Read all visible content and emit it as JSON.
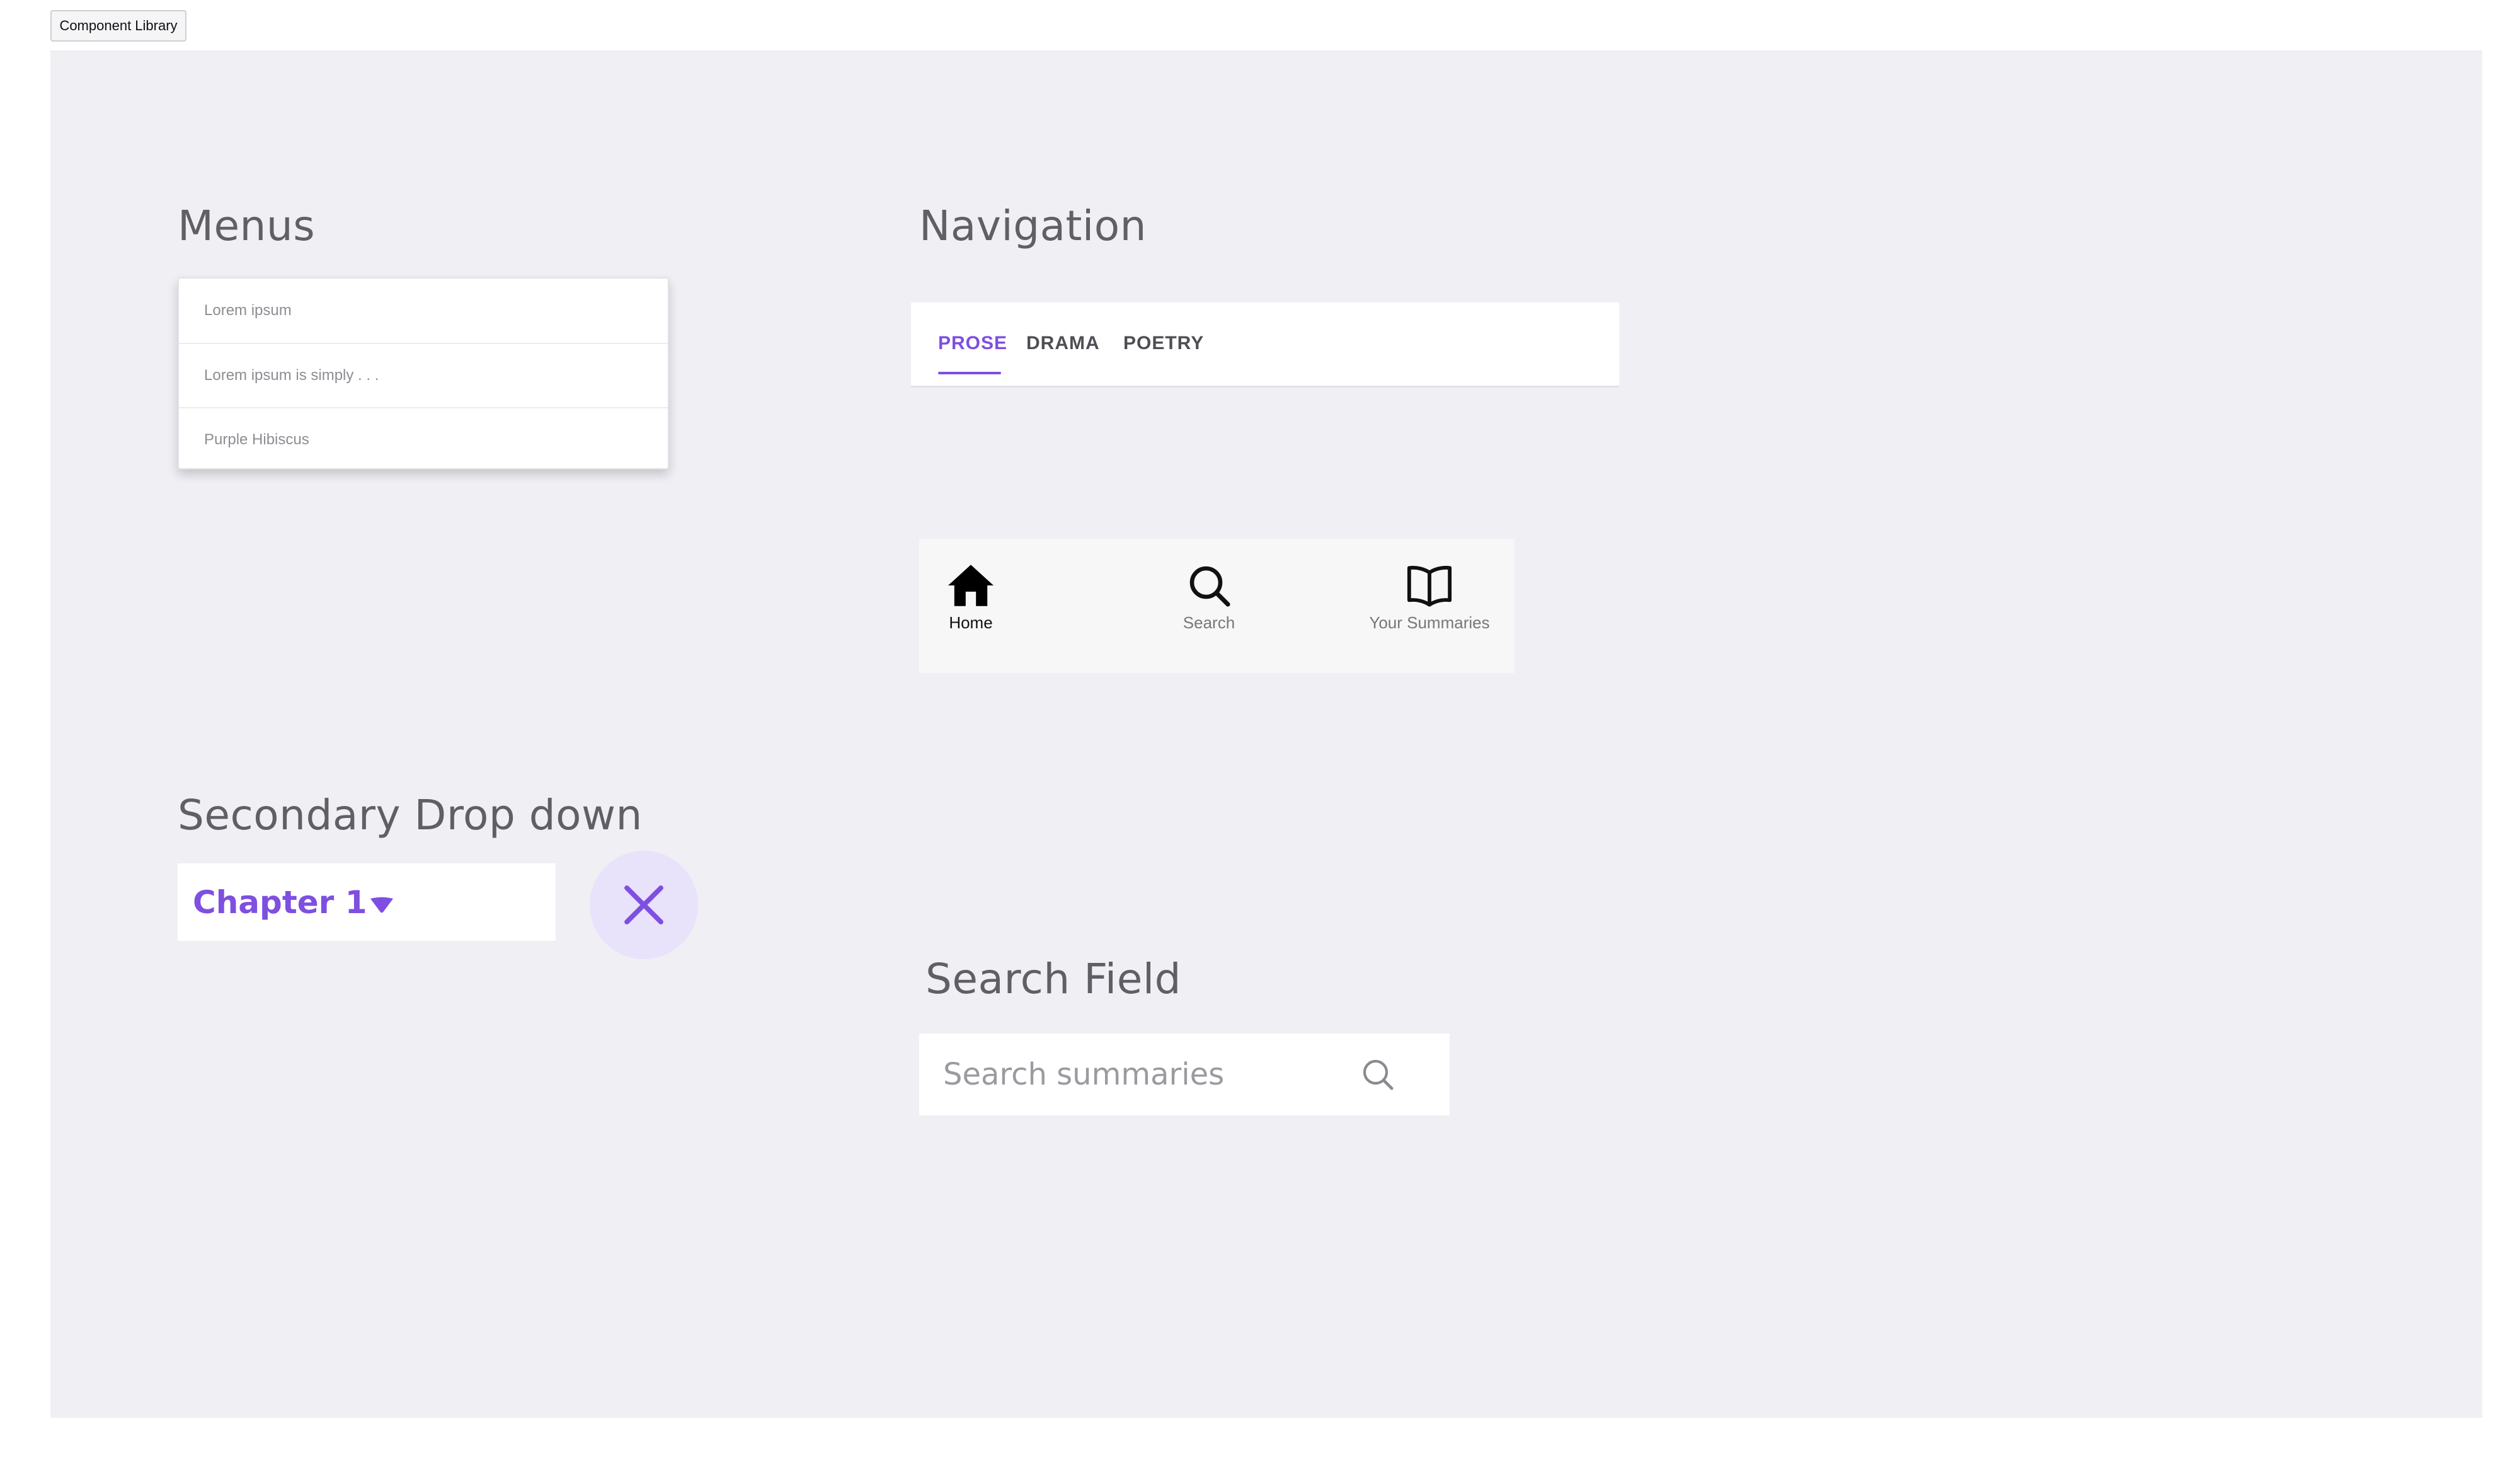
{
  "page_label": "Component Library",
  "menus": {
    "title": "Menus",
    "items": [
      "Lorem ipsum",
      "Lorem ipsum is simply . . .",
      "Purple Hibiscus"
    ]
  },
  "navigation": {
    "title": "Navigation",
    "tabs": [
      {
        "label": "PROSE",
        "active": true
      },
      {
        "label": "DRAMA",
        "active": false
      },
      {
        "label": "POETRY",
        "active": false
      }
    ],
    "bottom_nav": [
      {
        "label": "Home",
        "icon": "home-icon",
        "active": true
      },
      {
        "label": "Search",
        "icon": "search-icon",
        "active": false
      },
      {
        "label": "Your Summaries",
        "icon": "book-icon",
        "active": false
      }
    ]
  },
  "secondary_dropdown": {
    "title": "Secondary Drop down",
    "value": "Chapter 1",
    "caret_icon": "caret-down-icon",
    "close_icon": "close-icon"
  },
  "search_field": {
    "title": "Search Field",
    "placeholder": "Search summaries",
    "icon": "search-icon"
  },
  "colors": {
    "accent": "#7e4fe0",
    "canvas": "#f0eff4",
    "close_button_bg": "#e8e2fb"
  }
}
